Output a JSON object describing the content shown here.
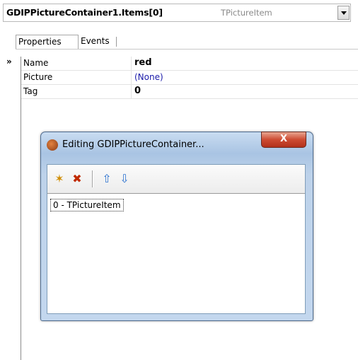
{
  "selector": {
    "object_name": "GDIPPictureContainer1.Items[0]",
    "object_type": "TPictureItem"
  },
  "tabs": [
    {
      "label": "Properties",
      "active": true
    },
    {
      "label": "Events",
      "active": false
    }
  ],
  "gutter": {
    "pointer": "»"
  },
  "properties": [
    {
      "name": "Name",
      "value": "red"
    },
    {
      "name": "Picture",
      "value": "(None)"
    },
    {
      "name": "Tag",
      "value": "0"
    }
  ],
  "dialog": {
    "title": "Editing GDIPPictureContainer...",
    "close_label": "X",
    "toolbar": [
      {
        "icon": "add-new-icon",
        "glyph": "✶"
      },
      {
        "icon": "delete-icon",
        "glyph": "✖"
      },
      {
        "icon": "move-up-icon",
        "glyph": "⇧"
      },
      {
        "icon": "move-down-icon",
        "glyph": "⇩"
      }
    ],
    "items": [
      "0 - TPictureItem"
    ]
  },
  "colors": {
    "link": "#1a1aaa",
    "close_button": "#cd4b32",
    "dialog_frame": "#a9c4e3"
  }
}
